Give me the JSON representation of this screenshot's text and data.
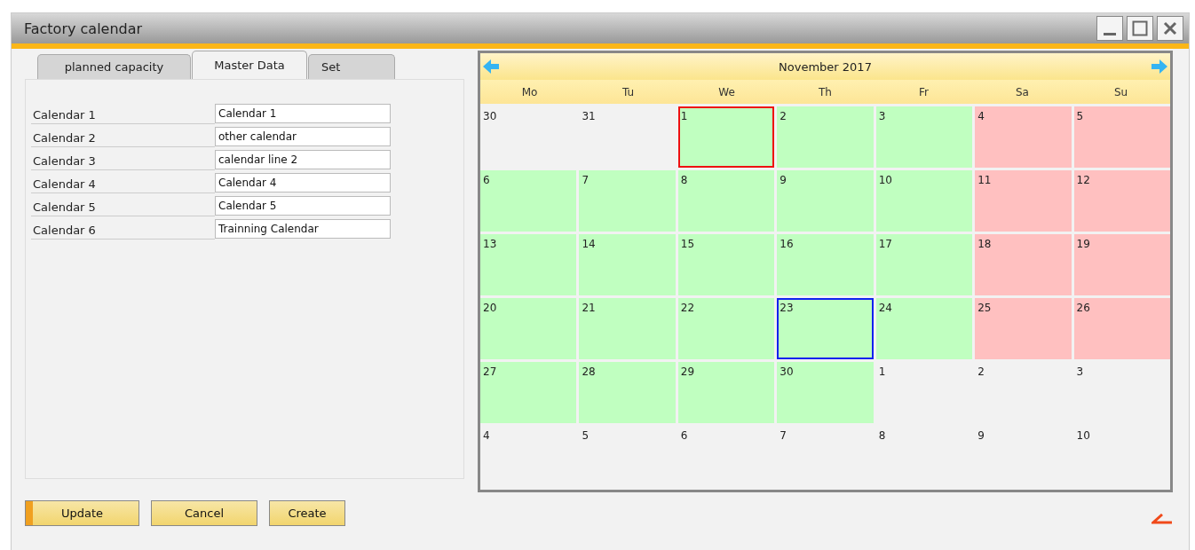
{
  "window": {
    "title": "Factory calendar"
  },
  "tabs": [
    {
      "label": "planned capacity",
      "selected": false
    },
    {
      "label": "Master Data",
      "selected": true
    },
    {
      "label": "Set",
      "selected": false
    }
  ],
  "calendars": [
    {
      "label": "Calendar 1",
      "value": "Calendar 1"
    },
    {
      "label": "Calendar 2",
      "value": "other calendar"
    },
    {
      "label": "Calendar 3",
      "value": "calendar line 2"
    },
    {
      "label": "Calendar 4",
      "value": "Calendar 4"
    },
    {
      "label": "Calendar 5",
      "value": "Calendar 5"
    },
    {
      "label": "Calendar 6",
      "value": "Trainning Calendar"
    }
  ],
  "buttons": [
    {
      "label": "Update",
      "default": true
    },
    {
      "label": "Cancel",
      "default": false
    },
    {
      "label": "Create",
      "default": false
    }
  ],
  "calendar": {
    "month": "November 2017",
    "weekdays": [
      "Mo",
      "Tu",
      "We",
      "Th",
      "Fr",
      "Sa",
      "Su"
    ],
    "weeks": [
      [
        {
          "day": "30",
          "kind": "outside",
          "today": false,
          "selected": false
        },
        {
          "day": "31",
          "kind": "outside",
          "today": false,
          "selected": false
        },
        {
          "day": "1",
          "kind": "work",
          "today": true,
          "selected": false
        },
        {
          "day": "2",
          "kind": "work",
          "today": false,
          "selected": false
        },
        {
          "day": "3",
          "kind": "work",
          "today": false,
          "selected": false
        },
        {
          "day": "4",
          "kind": "weekend",
          "today": false,
          "selected": false
        },
        {
          "day": "5",
          "kind": "weekend",
          "today": false,
          "selected": false
        }
      ],
      [
        {
          "day": "6",
          "kind": "work",
          "today": false,
          "selected": false
        },
        {
          "day": "7",
          "kind": "work",
          "today": false,
          "selected": false
        },
        {
          "day": "8",
          "kind": "work",
          "today": false,
          "selected": false
        },
        {
          "day": "9",
          "kind": "work",
          "today": false,
          "selected": false
        },
        {
          "day": "10",
          "kind": "work",
          "today": false,
          "selected": false
        },
        {
          "day": "11",
          "kind": "weekend",
          "today": false,
          "selected": false
        },
        {
          "day": "12",
          "kind": "weekend",
          "today": false,
          "selected": false
        }
      ],
      [
        {
          "day": "13",
          "kind": "work",
          "today": false,
          "selected": false
        },
        {
          "day": "14",
          "kind": "work",
          "today": false,
          "selected": false
        },
        {
          "day": "15",
          "kind": "work",
          "today": false,
          "selected": false
        },
        {
          "day": "16",
          "kind": "work",
          "today": false,
          "selected": false
        },
        {
          "day": "17",
          "kind": "work",
          "today": false,
          "selected": false
        },
        {
          "day": "18",
          "kind": "weekend",
          "today": false,
          "selected": false
        },
        {
          "day": "19",
          "kind": "weekend",
          "today": false,
          "selected": false
        }
      ],
      [
        {
          "day": "20",
          "kind": "work",
          "today": false,
          "selected": false
        },
        {
          "day": "21",
          "kind": "work",
          "today": false,
          "selected": false
        },
        {
          "day": "22",
          "kind": "work",
          "today": false,
          "selected": false
        },
        {
          "day": "23",
          "kind": "work",
          "today": false,
          "selected": true
        },
        {
          "day": "24",
          "kind": "work",
          "today": false,
          "selected": false
        },
        {
          "day": "25",
          "kind": "weekend",
          "today": false,
          "selected": false
        },
        {
          "day": "26",
          "kind": "weekend",
          "today": false,
          "selected": false
        }
      ],
      [
        {
          "day": "27",
          "kind": "work",
          "today": false,
          "selected": false
        },
        {
          "day": "28",
          "kind": "work",
          "today": false,
          "selected": false
        },
        {
          "day": "29",
          "kind": "work",
          "today": false,
          "selected": false
        },
        {
          "day": "30",
          "kind": "work",
          "today": false,
          "selected": false
        },
        {
          "day": "1",
          "kind": "outside",
          "today": false,
          "selected": false
        },
        {
          "day": "2",
          "kind": "outside",
          "today": false,
          "selected": false
        },
        {
          "day": "3",
          "kind": "outside",
          "today": false,
          "selected": false
        }
      ],
      [
        {
          "day": "4",
          "kind": "outside",
          "today": false,
          "selected": false
        },
        {
          "day": "5",
          "kind": "outside",
          "today": false,
          "selected": false
        },
        {
          "day": "6",
          "kind": "outside",
          "today": false,
          "selected": false
        },
        {
          "day": "7",
          "kind": "outside",
          "today": false,
          "selected": false
        },
        {
          "day": "8",
          "kind": "outside",
          "today": false,
          "selected": false
        },
        {
          "day": "9",
          "kind": "outside",
          "today": false,
          "selected": false
        },
        {
          "day": "10",
          "kind": "outside",
          "today": false,
          "selected": false
        }
      ]
    ]
  }
}
